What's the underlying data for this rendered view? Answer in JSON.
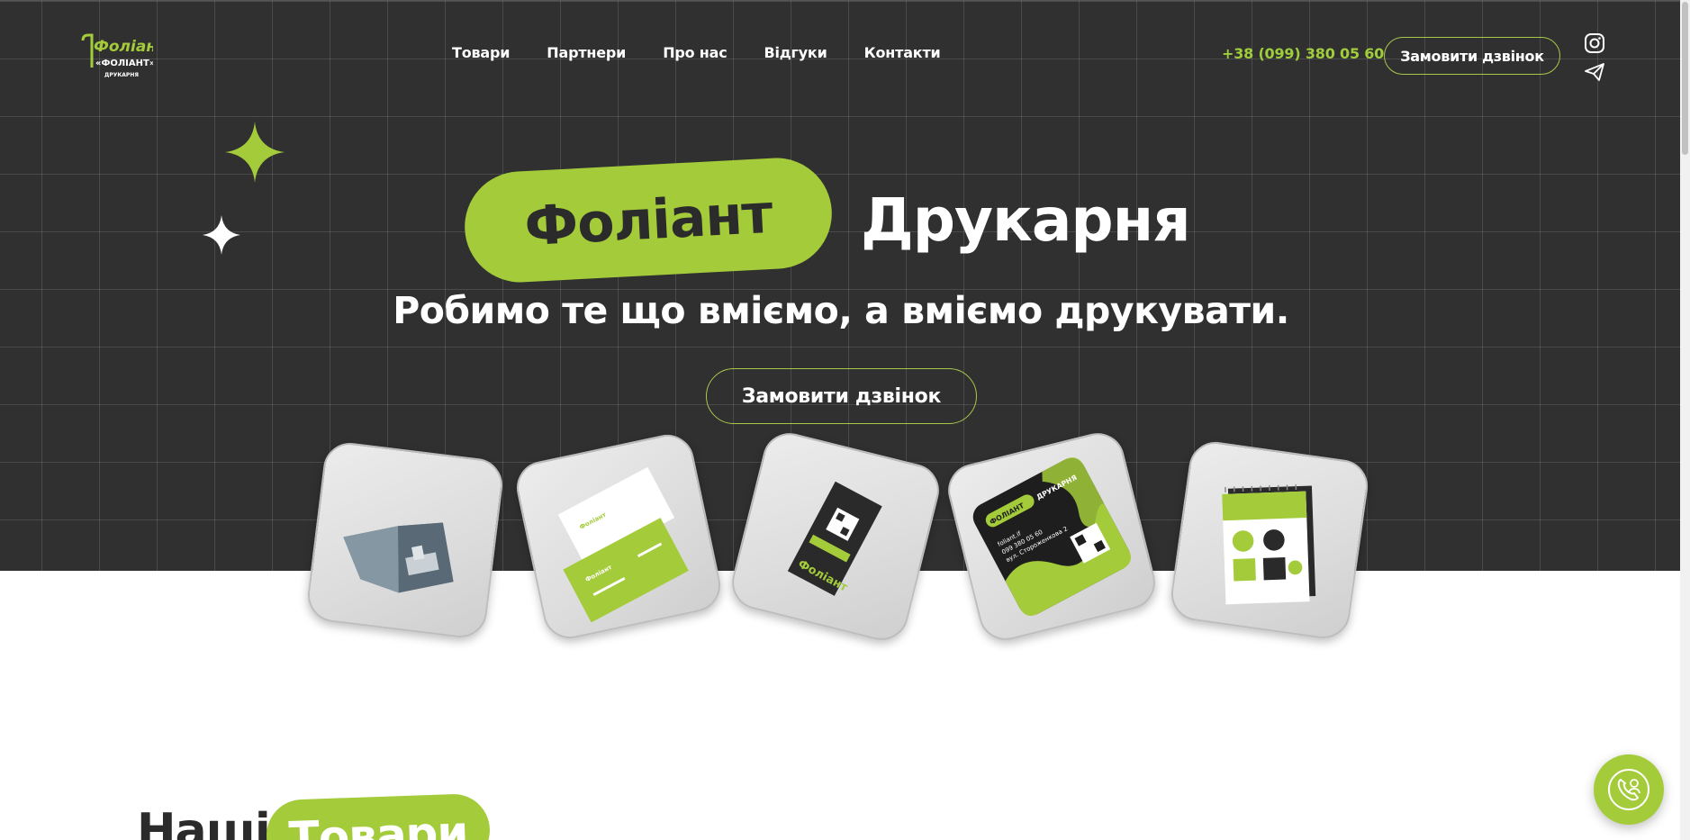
{
  "header": {
    "logo_text": "Фоліант",
    "logo_subtext": "«ФОЛІАНТ»",
    "logo_caption": "ДРУКАРНЯ",
    "nav": [
      "Товари",
      "Партнери",
      "Про нас",
      "Відгуки",
      "Контакти"
    ],
    "phone": "+38 (099) 380 05 60",
    "call_button": "Замовити дзвінок",
    "social_icons": [
      "instagram-icon",
      "telegram-icon"
    ]
  },
  "hero": {
    "title_highlight": "Фоліант",
    "title_rest": "Друкарня",
    "subtitle": "Робимо те що вміємо, а вміємо друкувати.",
    "call_button": "Замовити дзвінок"
  },
  "products": [
    {
      "name": "booklet"
    },
    {
      "name": "business-cards"
    },
    {
      "name": "flyer-qr",
      "text": "Фоліант"
    },
    {
      "name": "sticker",
      "text": "ФОЛІАНТ ДРУКАРНЯ",
      "lines": [
        "foliant.if",
        "099 380 05 60",
        "вул. Стороженкова 2"
      ]
    },
    {
      "name": "notebook"
    }
  ],
  "section": {
    "title_word": "Наші",
    "title_highlight": "Товари"
  },
  "colors": {
    "accent": "#a3cb3a",
    "phone": "#9fcd3b",
    "hero_bg": "#303030",
    "dark_text": "#2b2b2b"
  },
  "float_button_icon": "phone-call-icon"
}
